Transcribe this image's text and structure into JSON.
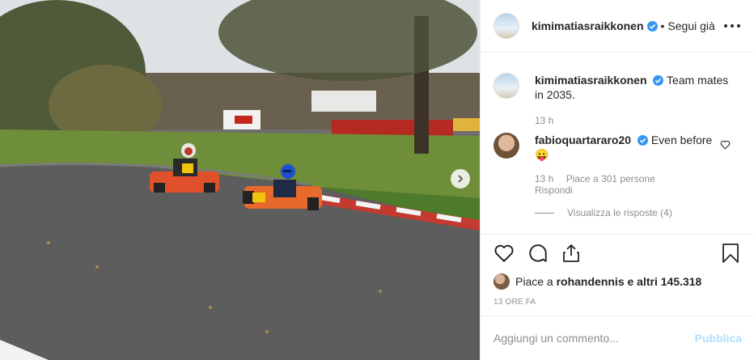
{
  "post": {
    "author": "kimimatiasraikkonen",
    "dot": "•",
    "follow_label": "Segui già",
    "more_icon": "more-horizontal-icon"
  },
  "comments": [
    {
      "username": "kimimatiasraikkonen",
      "text": "Team mates in 2035.",
      "time": "13 h"
    },
    {
      "username": "fabioquartararo20",
      "text": "Even before",
      "emoji": "😛",
      "time": "13 h",
      "likes": "Piace a 301 persone",
      "reply_label": "Rispondi",
      "view_replies": "Visualizza le risposte (4)"
    }
  ],
  "likes": {
    "prefix": "Piace a",
    "user": "rohandennis",
    "suffix": "e altri 145.318"
  },
  "timestamp": "13 ORE FA",
  "add_comment": {
    "placeholder": "Aggiungi un commento...",
    "publish": "Pubblica"
  },
  "colors": {
    "verified": "#3897f0",
    "publish_disabled": "#b2dffc",
    "meta": "#8e8e8e"
  }
}
